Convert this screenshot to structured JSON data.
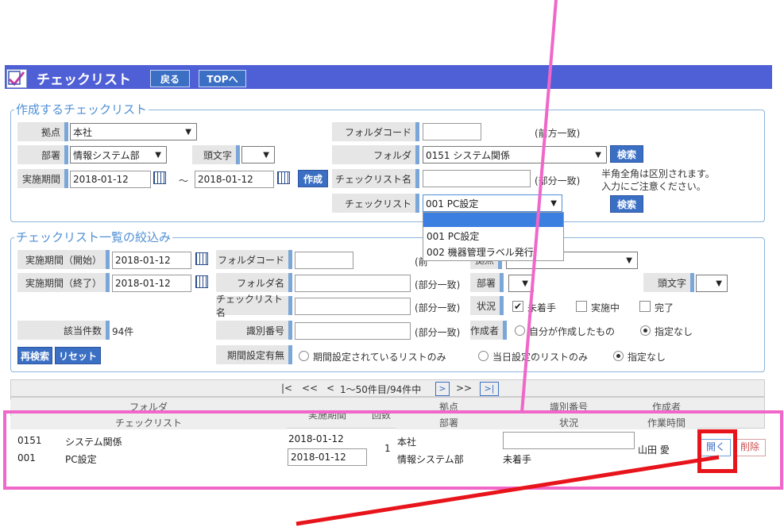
{
  "header": {
    "title": "チェックリスト",
    "back_label": "戻る",
    "top_label": "TOPへ"
  },
  "create_section": {
    "legend": "作成するチェックリスト",
    "base_label": "拠点",
    "base_value": "本社",
    "dept_label": "部署",
    "dept_value": "情報システム部",
    "initial_label": "頭文字",
    "period_label": "実施期間",
    "period_start": "2018-01-12",
    "period_sep": "～",
    "period_end": "2018-01-12",
    "create_button": "作成",
    "folder_code_label": "フォルダコード",
    "folder_code_note": "(前方一致)",
    "folder_label": "フォルダ",
    "folder_value": "0151 システム関係",
    "search_button": "検索",
    "checklist_name_label": "チェックリスト名",
    "checklist_name_note": "(部分一致)",
    "hint_line1": "半角全角は区別されます。",
    "hint_line2": "入力にご注意ください。",
    "checklist_label": "チェックリスト",
    "checklist_value": "001 PC設定",
    "search_button2": "検索",
    "dropdown_options": [
      "001 PC設定",
      "002 機器管理ラベル発行"
    ]
  },
  "filter_section": {
    "legend": "チェックリスト一覧の絞込み",
    "period_start_label": "実施期間（開始）",
    "period_start_value": "2018-01-12",
    "period_end_label": "実施期間（終了）",
    "period_end_value": "2018-01-12",
    "count_label": "該当件数",
    "count_value": "94件",
    "recheck_button": "再検索",
    "reset_button": "リセット",
    "folder_code_label": "フォルダコード",
    "folder_code_note_visible": "(前",
    "folder_name_label": "フォルダ名",
    "folder_name_note": "(部分一致)",
    "checklist_name_label": "チェックリスト名",
    "checklist_name_note": "(部分一致)",
    "id_label": "識別番号",
    "id_note": "(部分一致)",
    "period_setting_label": "期間設定有無",
    "period_opt1": "期間設定されているリストのみ",
    "period_opt2": "当日設定のリストのみ",
    "period_opt3": "指定なし",
    "base_label_visible": "拠点",
    "dept_label": "部署",
    "initial_label": "頭文字",
    "status_label": "状況",
    "status_opt1": "未着手",
    "status_opt2": "実施中",
    "status_opt3": "完了",
    "creator_label": "作成者",
    "creator_opt1": "自分が作成したもの",
    "creator_opt2": "指定なし"
  },
  "pagination": {
    "first": "|<",
    "prev2": "<<",
    "prev": "<",
    "range": "1～50件目/94件中",
    "next": ">",
    "next2": ">>",
    "last": ">|"
  },
  "table": {
    "headers": {
      "folder": "フォルダ",
      "checklist": "チェックリスト",
      "period": "実施期間",
      "count": "回数",
      "base": "拠点",
      "dept": "部署",
      "id": "識別番号",
      "status": "状況",
      "creator": "作成者",
      "work_time": "作業時間"
    },
    "row": {
      "folder_code": "0151",
      "folder_name": "システム関係",
      "checklist_code": "001",
      "checklist_name": "PC設定",
      "period_start": "2018-01-12",
      "period_end": "2018-01-12",
      "count": "1",
      "base": "本社",
      "dept": "情報システム部",
      "status": "未着手",
      "creator": "山田 愛",
      "open_button": "開く",
      "delete_button": "削除"
    }
  },
  "colors": {
    "header_bg": "#4f5fd6",
    "accent_blue": "#3b6fc4",
    "annotation_pink": "#f067c9",
    "annotation_red": "#e8141b"
  }
}
